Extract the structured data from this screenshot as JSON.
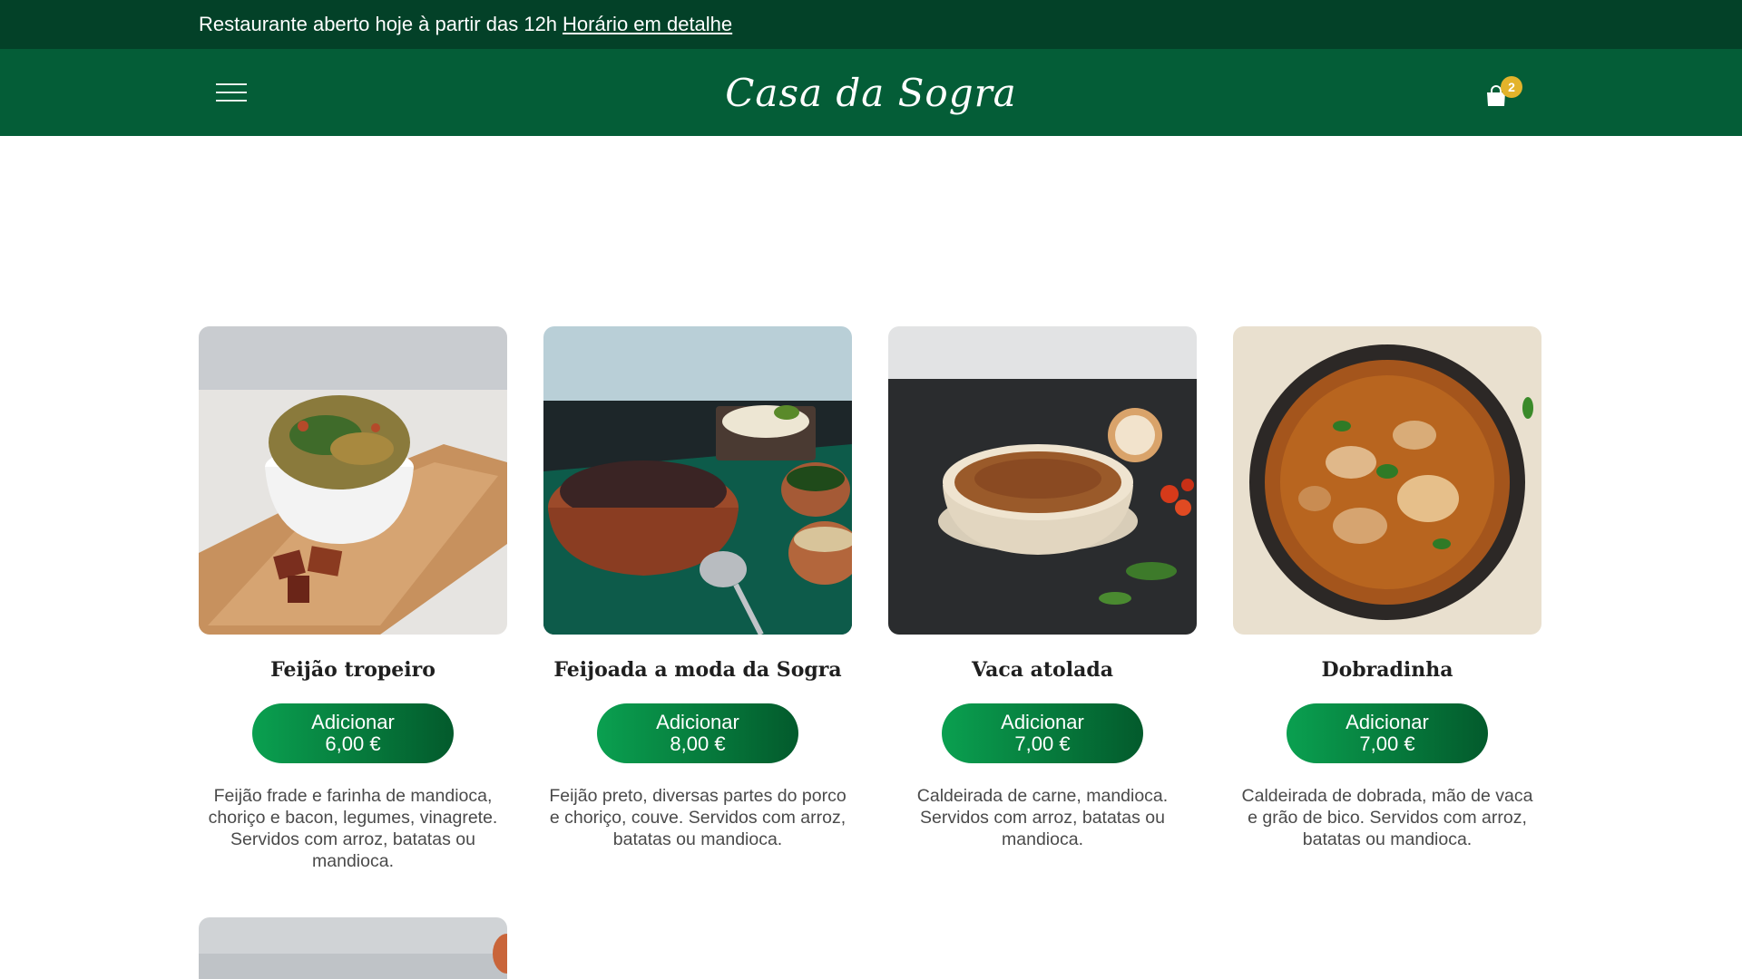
{
  "announcement": {
    "text": "Restaurante aberto hoje à partir das 12h",
    "link_label": "Horário em detalhe"
  },
  "header": {
    "logo_text": "Casa da Sogra",
    "cart_count": "2",
    "menu_icon": "hamburger-icon",
    "cart_icon": "shopping-bag-icon"
  },
  "colors": {
    "top_bar": "#034128",
    "header": "#045d37",
    "button_start": "#0aa050",
    "button_end": "#035a2c",
    "badge": "#e3b32b"
  },
  "products": [
    {
      "name": "Feijão tropeiro",
      "button_line1": "Adicionar",
      "price": "6,00 €",
      "description": "Feijão frade e farinha de mandioca, choriço e bacon, legumes, vinagrete. Servidos com arroz, batatas ou mandioca."
    },
    {
      "name": "Feijoada a moda da Sogra",
      "button_line1": "Adicionar",
      "price": "8,00 €",
      "description": "Feijão preto, diversas partes do porco e choriço, couve. Servidos com arroz, batatas ou mandioca."
    },
    {
      "name": "Vaca atolada",
      "button_line1": "Adicionar",
      "price": "7,00 €",
      "description": "Caldeirada de carne, mandioca. Servidos com arroz, batatas ou mandioca."
    },
    {
      "name": "Dobradinha",
      "button_line1": "Adicionar",
      "price": "7,00 €",
      "description": "Caldeirada de dobrada, mão de vaca e grão de bico. Servidos com arroz, batatas ou mandioca."
    }
  ]
}
